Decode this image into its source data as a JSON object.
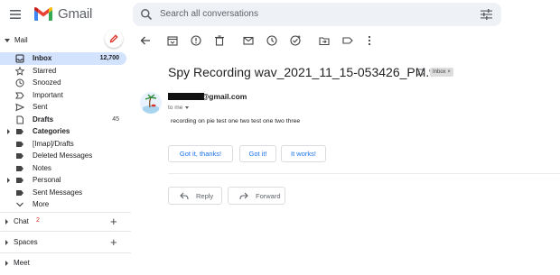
{
  "app": {
    "name": "Gmail",
    "brand_colors": {
      "red": "#ea4335",
      "blue": "#4285f4",
      "green": "#34a853",
      "yellow": "#fbbc04"
    }
  },
  "search": {
    "placeholder": "Search all conversations"
  },
  "sidebar": {
    "mail_label": "Mail",
    "items": [
      {
        "label": "Inbox",
        "count": "12,700",
        "icon": "inbox-icon",
        "active": true
      },
      {
        "label": "Starred",
        "icon": "star-icon"
      },
      {
        "label": "Snoozed",
        "icon": "clock-icon"
      },
      {
        "label": "Important",
        "icon": "important-icon"
      },
      {
        "label": "Sent",
        "icon": "send-icon"
      },
      {
        "label": "Drafts",
        "count": "45",
        "icon": "draft-icon",
        "bold": true
      },
      {
        "label": "Categories",
        "icon": "label-icon",
        "bold": true,
        "expandable": true
      },
      {
        "label": "[Imap]/Drafts",
        "icon": "label-icon"
      },
      {
        "label": "Deleted Messages",
        "icon": "label-icon"
      },
      {
        "label": "Notes",
        "icon": "label-icon"
      },
      {
        "label": "Personal",
        "icon": "label-icon",
        "expandable": true
      },
      {
        "label": "Sent Messages",
        "icon": "label-icon"
      },
      {
        "label": "More",
        "icon": "chevron-down-icon"
      }
    ],
    "chat": {
      "label": "Chat",
      "badge": "2"
    },
    "spaces": {
      "label": "Spaces"
    },
    "meet": {
      "label": "Meet"
    }
  },
  "toolbar": {
    "icons": [
      "back-arrow-icon",
      "archive-icon",
      "report-spam-icon",
      "delete-icon",
      "mark-unread-icon",
      "snooze-icon",
      "add-task-icon",
      "move-to-icon",
      "labels-icon",
      "more-vert-icon"
    ]
  },
  "email": {
    "subject": "Spy Recording wav_2021_11_15-053426_PM.wav",
    "label_chip": "Inbox ×",
    "sender_domain": "@gmail.com",
    "to_line": "to me",
    "body": "recording on pie test one two test one two three",
    "smart_replies": [
      "Got it, thanks!",
      "Got it!",
      "It works!"
    ],
    "actions": {
      "reply": "Reply",
      "forward": "Forward"
    }
  }
}
